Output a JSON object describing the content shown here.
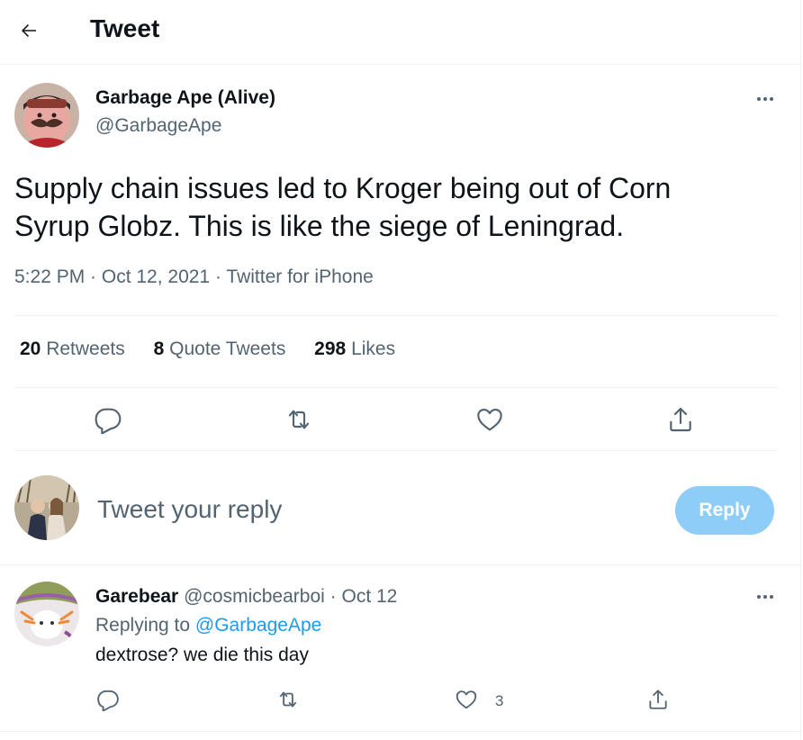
{
  "header": {
    "title": "Tweet",
    "back_icon": "arrow-left-icon"
  },
  "tweet": {
    "author_name": "Garbage Ape (Alive)",
    "author_handle": "@GarbageApe",
    "text": "Supply chain issues led to Kroger being out of Corn Syrup Globz. This is like the siege of Leningrad.",
    "meta": "5:22 PM · Oct 12, 2021 · Twitter for iPhone",
    "stats": {
      "retweets_count": "20",
      "retweets_label": "Retweets",
      "quotes_count": "8",
      "quotes_label": "Quote Tweets",
      "likes_count": "298",
      "likes_label": "Likes"
    },
    "actions": [
      "reply-icon",
      "retweet-icon",
      "like-icon",
      "share-icon"
    ]
  },
  "composer": {
    "placeholder": "Tweet your reply",
    "button_label": "Reply",
    "button_color": "#8ecdf7"
  },
  "reply": {
    "author_name": "Garebear",
    "author_handle": "@cosmicbearboi",
    "separator": "·",
    "date": "Oct 12",
    "replying_prefix": "Replying to",
    "replying_handle": "@GarbageApe",
    "text": "dextrose? we die this day",
    "like_count": "3"
  },
  "colors": {
    "text": "#0f1419",
    "secondary": "#536471",
    "link": "#1d9bf0",
    "divider": "#eff3f4"
  }
}
